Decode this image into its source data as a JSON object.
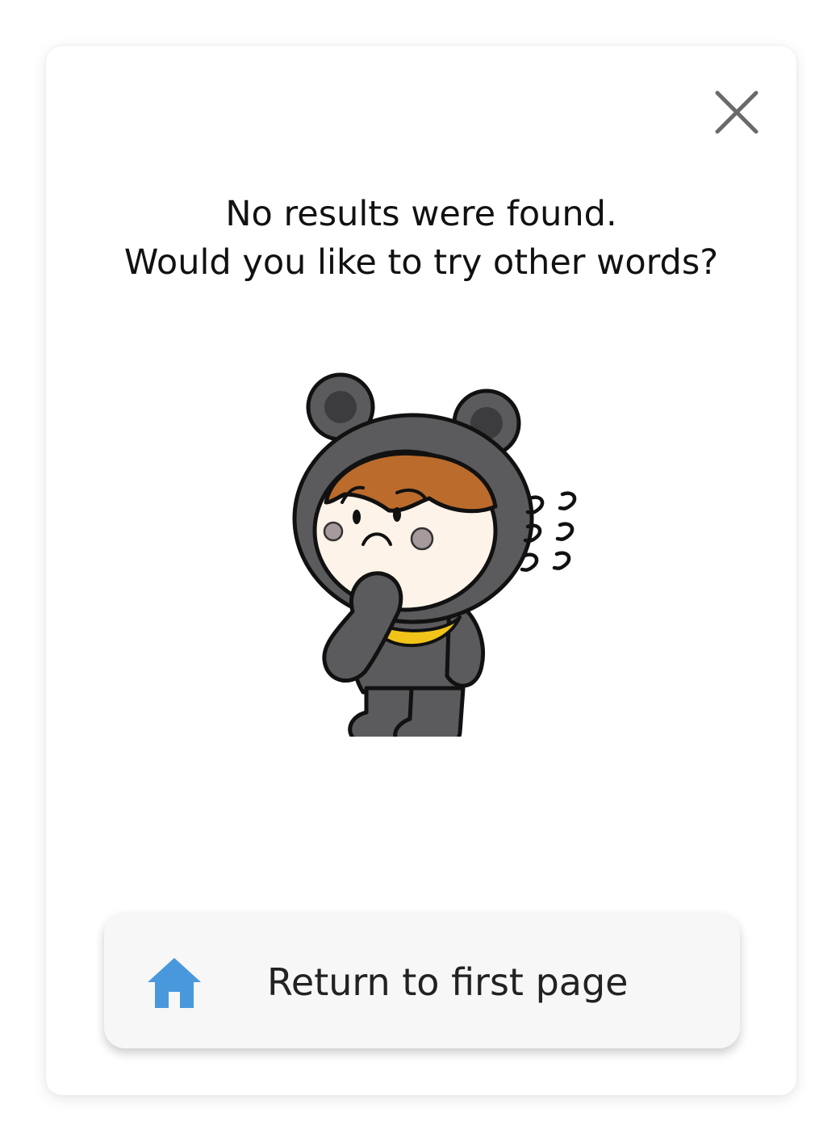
{
  "dialog": {
    "message_line1": "No results were found.",
    "message_line2": "Would you like to try other words?",
    "close_icon": "close-icon",
    "illustration": "confused-bear-costume-character"
  },
  "home_button": {
    "label": "Return to first page",
    "icon": "home-icon",
    "icon_color": "#4a98dc"
  },
  "colors": {
    "text": "#111111",
    "button_bg": "#f7f7f7",
    "costume": "#5b5b5e",
    "hair": "#bb6b2c",
    "skin": "#fdf3e8",
    "moon": "#f2c41a"
  }
}
